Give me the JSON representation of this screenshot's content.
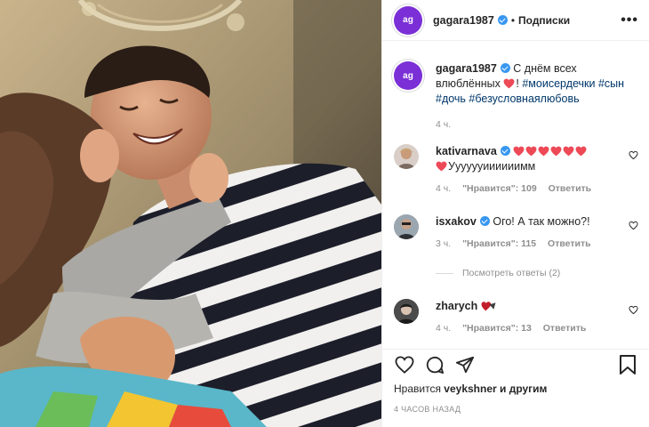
{
  "photo": {
    "alt": ""
  },
  "header": {
    "username": "gagara1987",
    "separator": "•",
    "follow_label": "Подписки",
    "more_label": "•••",
    "avatar_letters": "ag"
  },
  "caption": {
    "username": "gagara1987",
    "text_before": " С днём всех влюблённых ",
    "text_after": "! ",
    "hashtags": "#моисердечки #сын #дочь #безусловнаялюбовь",
    "time": "4 ч."
  },
  "comments": [
    {
      "username": "kativarnava",
      "verified": true,
      "text": "Ууууууиииииимм",
      "hearts": 7,
      "time": "4 ч.",
      "likes": "\"Нравится\": 109",
      "reply": "Ответить"
    },
    {
      "username": "isxakov",
      "verified": true,
      "text": " Ого! А так можно?!",
      "time": "3 ч.",
      "likes": "\"Нравится\": 115",
      "reply": "Ответить"
    },
    {
      "username": "zharych",
      "verified": false,
      "text": "",
      "time": "4 ч.",
      "likes": "\"Нравится\": 13",
      "reply": "Ответить"
    }
  ],
  "view_replies": "Посмотреть ответы (2)",
  "footer": {
    "liked_by_prefix": "Нравится ",
    "liked_by_user": "veykshner",
    "liked_by_suffix": " и другим",
    "timestamp": "4 ЧАСОВ НАЗАД"
  },
  "colors": {
    "brand_avatar": "#7b2fd6",
    "verified": "#3897f0",
    "heart": "#ed4956",
    "hashtag": "#00376b",
    "muted": "#8e8e8e"
  },
  "icons": [
    "heart-outline-icon",
    "comment-icon",
    "share-icon",
    "bookmark-icon",
    "verified-badge-icon"
  ]
}
